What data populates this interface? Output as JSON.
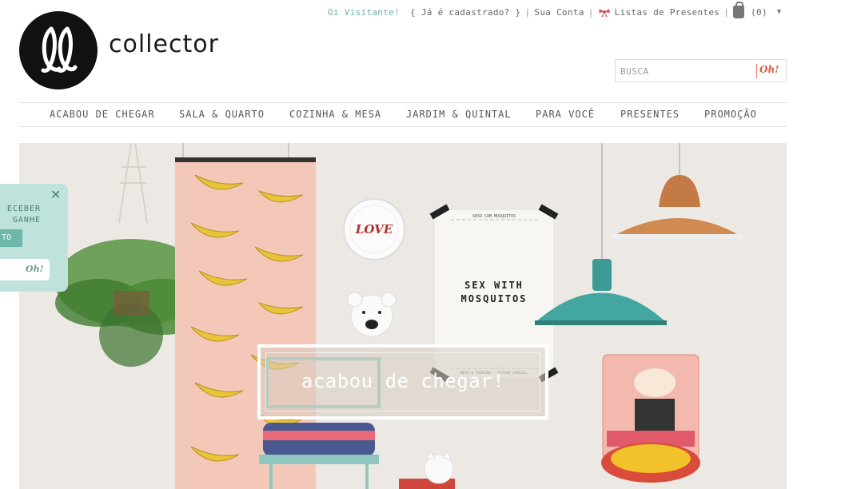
{
  "topbar": {
    "greeting": "Oi Visitante!",
    "registered": "{ Já é cadastrado? }",
    "account": "Sua Conta",
    "gift_lists": "Listas de Presentes",
    "cart_count": "(0)",
    "caret": "▼"
  },
  "logo": {
    "text": "collector"
  },
  "search": {
    "placeholder": "BUSCA",
    "button_label": "Oh!"
  },
  "nav": {
    "items": [
      "ACABOU DE CHEGAR",
      "SALA & QUARTO",
      "COZINHA & MESA",
      "JARDIM & QUINTAL",
      "PARA VOCÊ",
      "PRESENTES",
      "PROMOÇÃO"
    ]
  },
  "hero": {
    "label": "acabou de chegar!",
    "plate_text": "LOVE",
    "poster_title": "SEX WITH\nMOSQUITOS",
    "poster_small_top": "SEXO COM MOSQUITOS",
    "poster_small_bottom": "MESA & CADEIRA · ARTHUR SURVILL"
  },
  "popup": {
    "line1": "ECEBER",
    "line2": "GANHE",
    "flag": "TO",
    "button_label": "Oh!",
    "close": "✕"
  },
  "colors": {
    "accent_teal": "#6ab0a4",
    "accent_orange": "#e05a3a",
    "popup_bg": "#bfe3dc",
    "hero_bg": "#ece9e4"
  }
}
